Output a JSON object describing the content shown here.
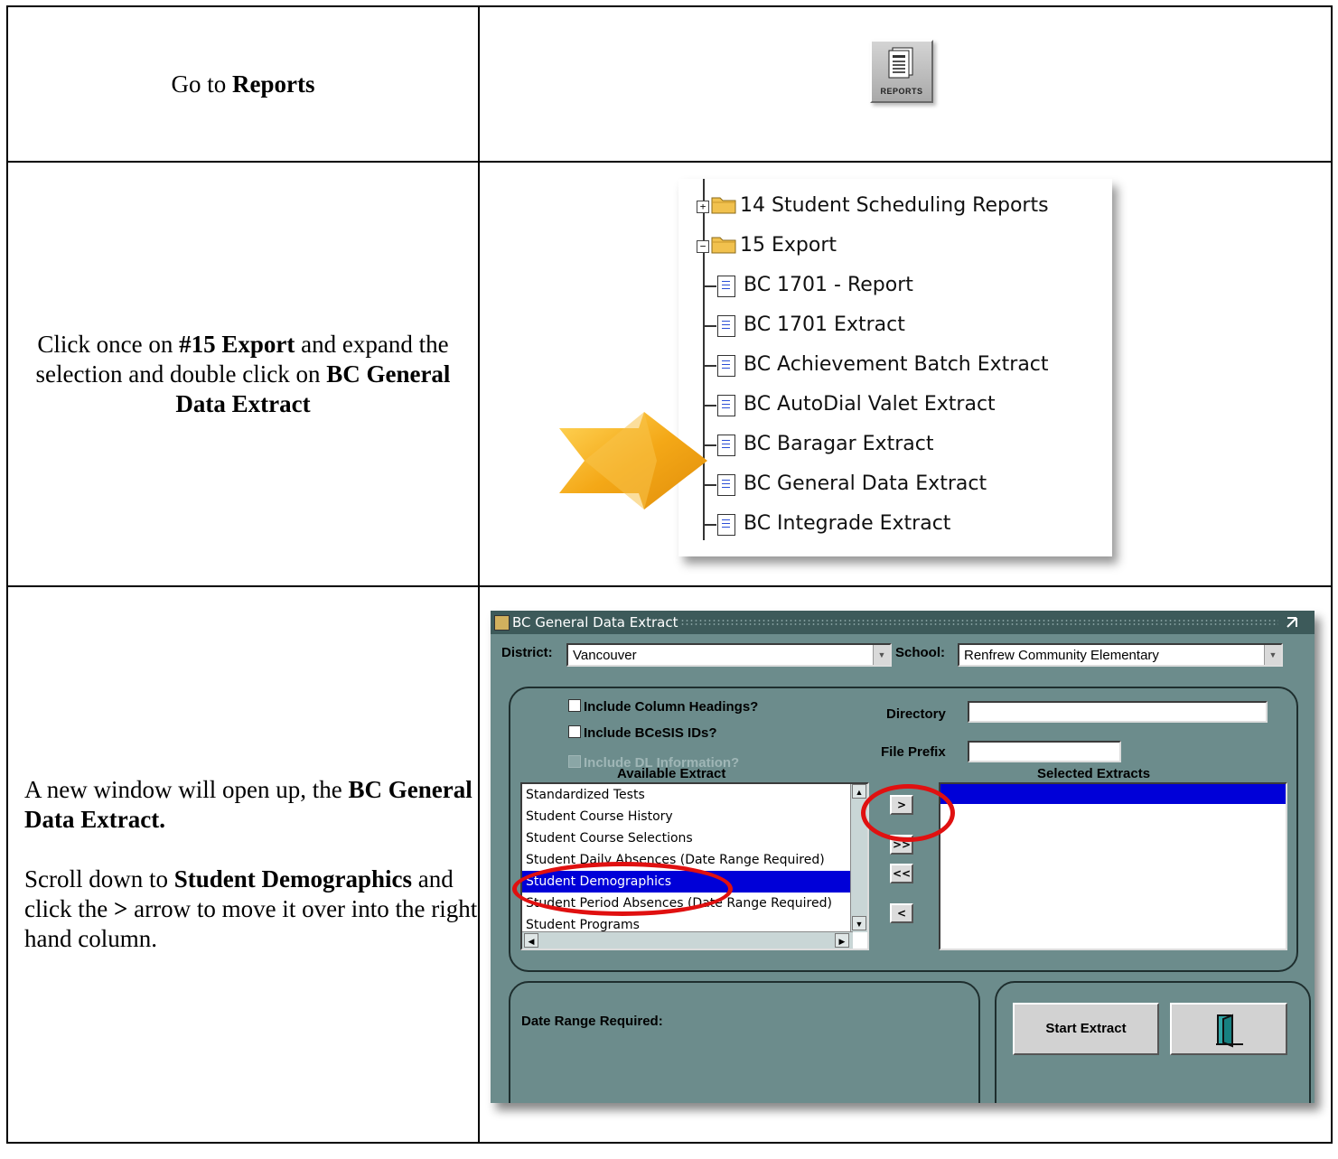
{
  "row1": {
    "instruction_prefix": "Go to ",
    "instruction_bold": "Reports",
    "reports_button_label": "REPORTS"
  },
  "row2": {
    "instruction": {
      "t1": "Click once on ",
      "b1": "#15 Export",
      "t2": " and expand the selection and double click on ",
      "b2": "BC General Data Extract"
    },
    "tree": {
      "folders": [
        "14 Student Scheduling Reports",
        "15 Export"
      ],
      "items": [
        "BC 1701 - Report",
        "BC 1701 Extract",
        "BC Achievement Batch Extract",
        "BC AutoDial Valet Extract",
        "BC Baragar Extract",
        "BC General Data Extract",
        "BC Integrade Extract"
      ]
    }
  },
  "row3": {
    "instruction": {
      "t1": "A new window will open up, the ",
      "b1": "BC General Data Extract.",
      "t2": "Scroll down to ",
      "b2": "Student Demographics",
      "t3": " and click the ",
      "b3": ">",
      "t4": " arrow to move it over into the right hand column."
    },
    "window": {
      "title": "BC General Data Extract",
      "district_label": "District:",
      "district_value": "Vancouver",
      "school_label": "School:",
      "school_value": "Renfrew Community Elementary",
      "chk_column_headings": "Include Column Headings?",
      "chk_bcesis_ids": "Include BCeSIS IDs?",
      "chk_dl_info": "Include DL Information?",
      "directory_label": "Directory",
      "file_prefix_label": "File Prefix",
      "available_header": "Available Extract",
      "selected_header": "Selected Extracts",
      "available_items": [
        "Standardized Tests",
        "Student Course History",
        "Student Course Selections",
        "Student Daily Absences (Date Range Required)",
        "Student Demographics",
        "Student Period Absences (Date Range Required)",
        "Student Programs"
      ],
      "selected_index": 4,
      "move_buttons": [
        ">",
        ">>",
        "<<",
        "<"
      ],
      "date_range_label": "Date Range Required:",
      "start_extract": "Start Extract"
    }
  },
  "colors": {
    "window_bg": "#6c8c8c",
    "titlebar": "#3d5a5a",
    "selection": "#0000d8",
    "highlight_ring": "#e01010",
    "arrow": "#f2a516"
  }
}
